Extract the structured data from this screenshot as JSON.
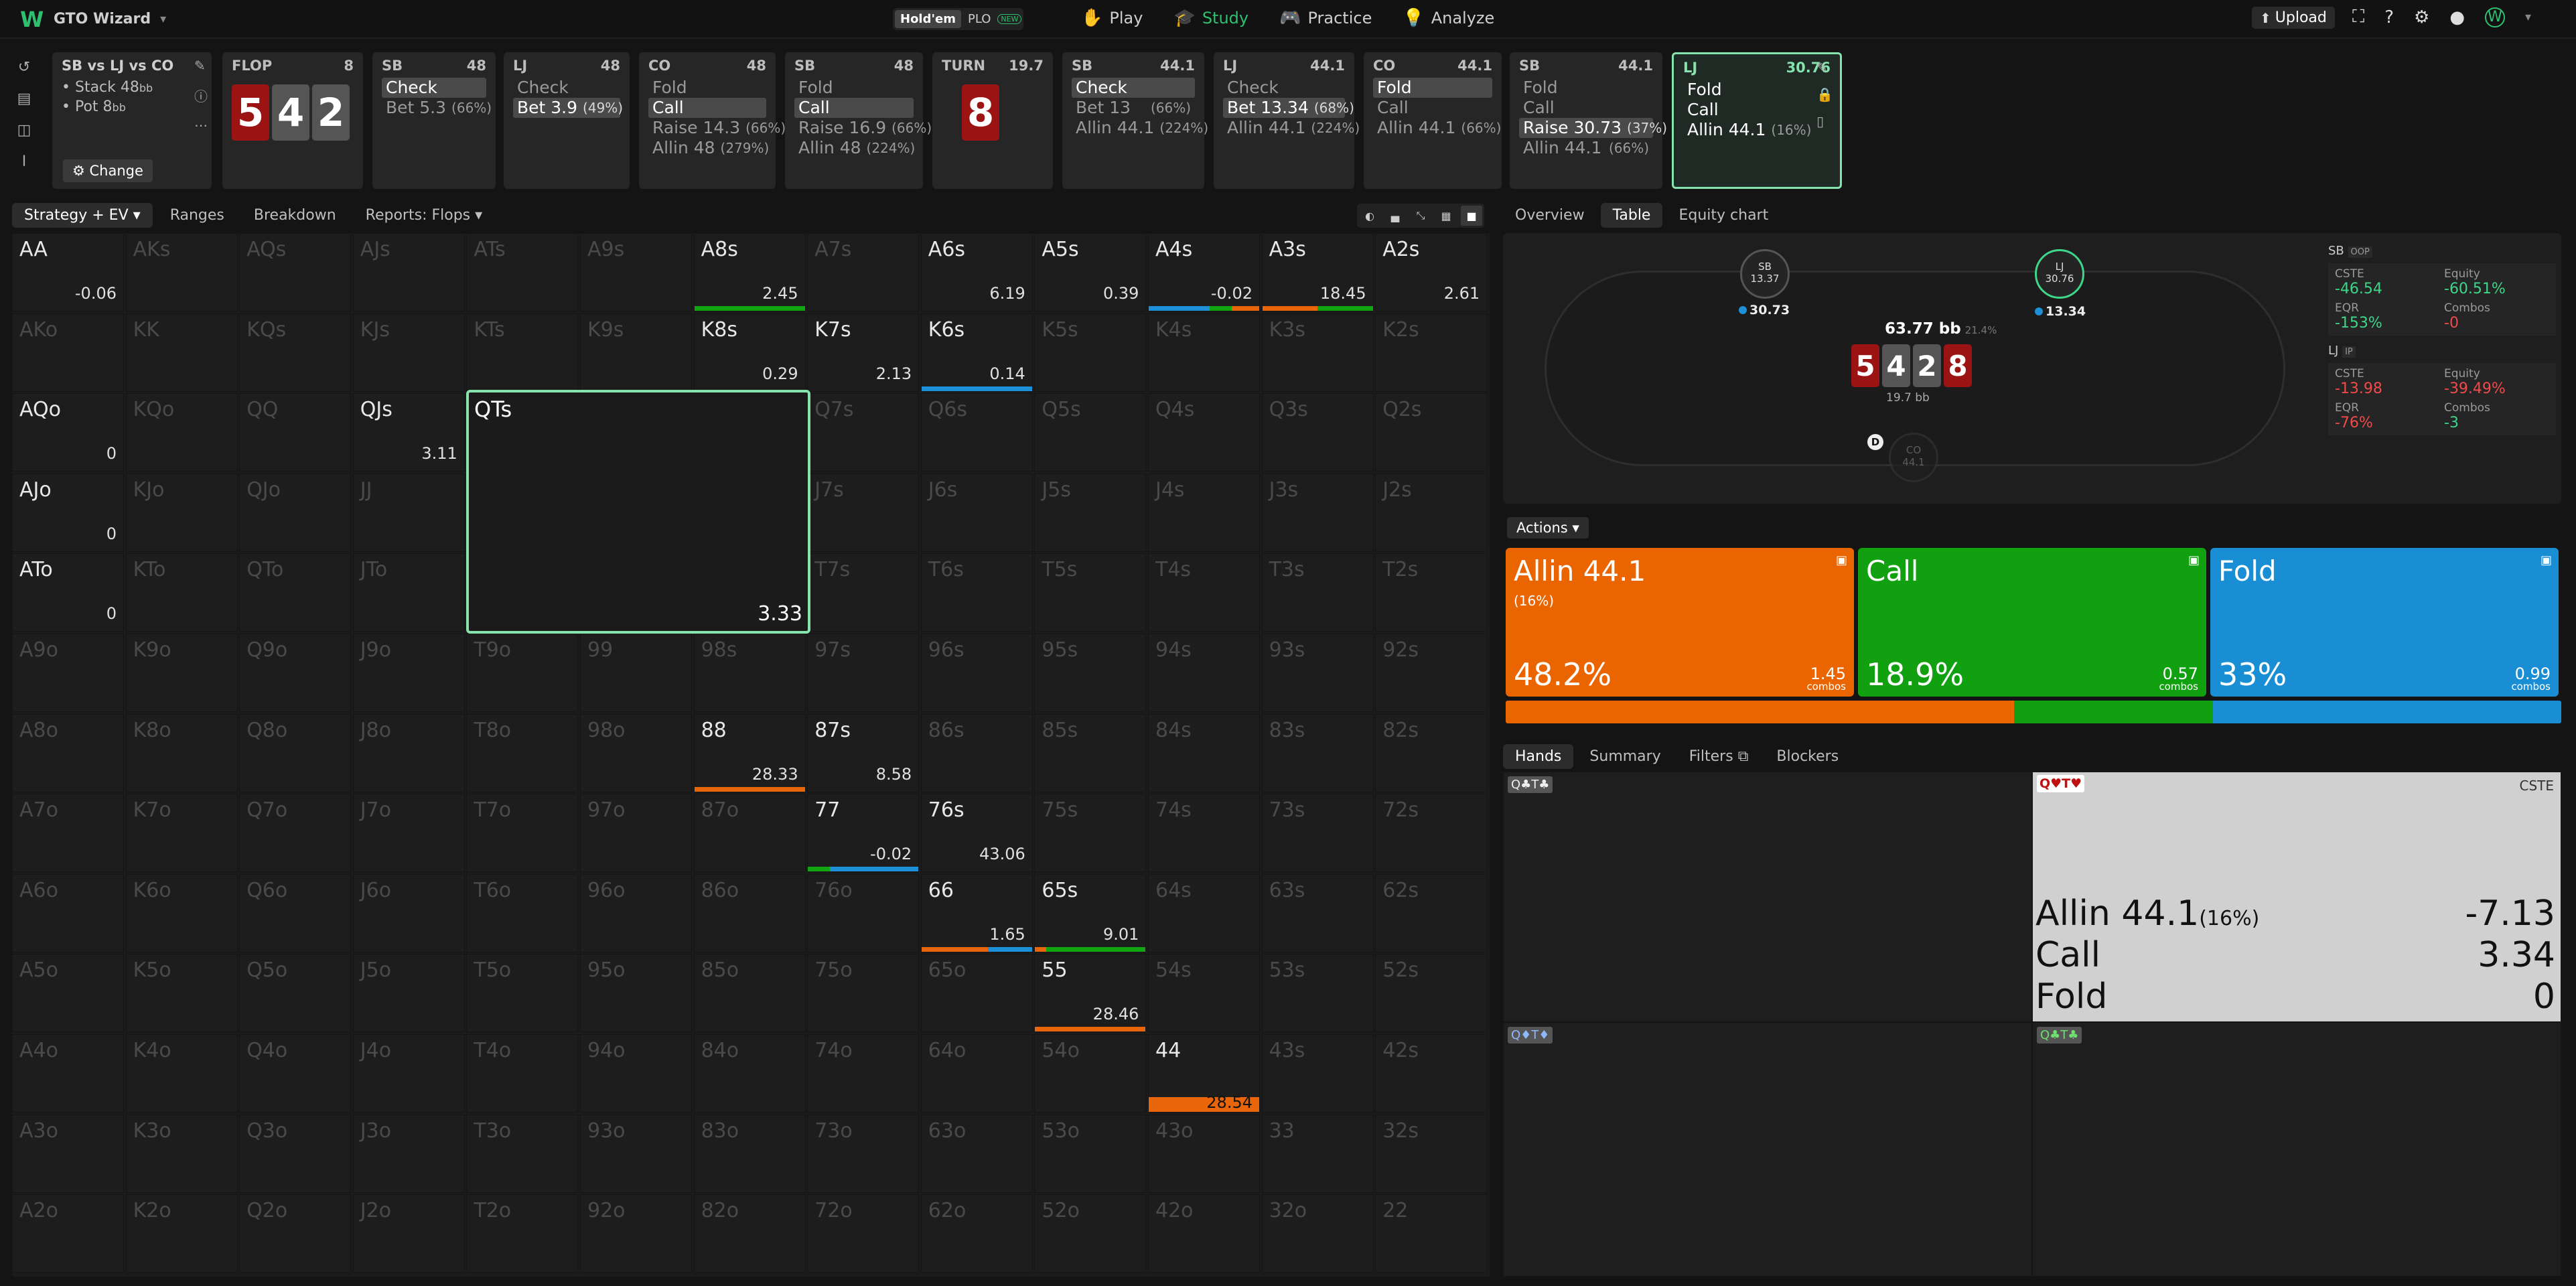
{
  "nav": {
    "brand": "GTO Wizard",
    "game_tabs": [
      "Hold'em",
      "PLO"
    ],
    "plo_badge": "NEW",
    "menu": [
      "Play",
      "Study",
      "Practice",
      "Analyze"
    ],
    "upload": "Upload",
    "accent": "#2fbf71"
  },
  "spot": {
    "title": "SB vs LJ vs CO",
    "stack": "Stack 48",
    "stack_unit": "bb",
    "pot": "Pot 8",
    "pot_unit": "bb",
    "change": "Change"
  },
  "actions_bar": [
    {
      "pos": "FLOP",
      "val": "8",
      "board": [
        "5",
        "4",
        "2"
      ]
    },
    {
      "pos": "SB",
      "val": "48",
      "rows": [
        {
          "t": "Check",
          "p": "",
          "sel": true
        },
        {
          "t": "Bet 5.3",
          "p": "(66%)",
          "sel": false
        }
      ]
    },
    {
      "pos": "LJ",
      "val": "48",
      "rows": [
        {
          "t": "Check",
          "p": "",
          "sel": false
        },
        {
          "t": "Bet 3.9",
          "p": "(49%)",
          "sel": true
        }
      ]
    },
    {
      "pos": "CO",
      "val": "48",
      "rows": [
        {
          "t": "Fold",
          "p": "",
          "sel": false
        },
        {
          "t": "Call",
          "p": "",
          "sel": true
        },
        {
          "t": "Raise 14.3",
          "p": "(66%)",
          "sel": false
        },
        {
          "t": "Allin 48",
          "p": "(279%)",
          "sel": false
        }
      ]
    },
    {
      "pos": "SB",
      "val": "48",
      "rows": [
        {
          "t": "Fold",
          "p": "",
          "sel": false
        },
        {
          "t": "Call",
          "p": "",
          "sel": true
        },
        {
          "t": "Raise 16.9",
          "p": "(66%)",
          "sel": false
        },
        {
          "t": "Allin 48",
          "p": "(224%)",
          "sel": false
        }
      ]
    },
    {
      "pos": "TURN",
      "val": "19.7",
      "board": [
        "8"
      ]
    },
    {
      "pos": "SB",
      "val": "44.1",
      "rows": [
        {
          "t": "Check",
          "p": "",
          "sel": true
        },
        {
          "t": "Bet 13",
          "p": "(66%)",
          "sel": false
        },
        {
          "t": "Allin 44.1",
          "p": "(224%)",
          "sel": false
        }
      ]
    },
    {
      "pos": "LJ",
      "val": "44.1",
      "rows": [
        {
          "t": "Check",
          "p": "",
          "sel": false
        },
        {
          "t": "Bet 13.34",
          "p": "(68%)",
          "sel": true
        },
        {
          "t": "Allin 44.1",
          "p": "(224%)",
          "sel": false
        }
      ]
    },
    {
      "pos": "CO",
      "val": "44.1",
      "rows": [
        {
          "t": "Fold",
          "p": "",
          "sel": true
        },
        {
          "t": "Call",
          "p": "",
          "sel": false
        },
        {
          "t": "Allin 44.1",
          "p": "(66%)",
          "sel": false
        }
      ]
    },
    {
      "pos": "SB",
      "val": "44.1",
      "rows": [
        {
          "t": "Fold",
          "p": "",
          "sel": false
        },
        {
          "t": "Call",
          "p": "",
          "sel": false
        },
        {
          "t": "Raise 30.73",
          "p": "(37%)",
          "sel": true
        },
        {
          "t": "Allin 44.1",
          "p": "(66%)",
          "sel": false
        }
      ]
    },
    {
      "pos": "LJ",
      "val": "30.76",
      "rows": [
        {
          "t": "Fold",
          "p": "",
          "sel": false
        },
        {
          "t": "Call",
          "p": "",
          "sel": false
        },
        {
          "t": "Allin 44.1",
          "p": "(16%)",
          "sel": false
        }
      ]
    }
  ],
  "grid_tabs": [
    "Strategy + EV",
    "Ranges",
    "Breakdown",
    "Reports: Flops"
  ],
  "ranks": [
    "A",
    "K",
    "Q",
    "J",
    "T",
    "9",
    "8",
    "7",
    "6",
    "5",
    "4",
    "3",
    "2"
  ],
  "active_cells": {
    "AA": {
      "ev": "-0.06",
      "bar": [
        [
          "#1e90d8",
          0.0
        ],
        [
          "#11a511",
          0.0
        ],
        [
          "#e8650a",
          0.0
        ]
      ]
    },
    "A8s": {
      "ev": "2.45",
      "bar": [
        [
          "#11a511",
          1.0
        ]
      ]
    },
    "A6s": {
      "ev": "6.19",
      "bar": []
    },
    "A5s": {
      "ev": "0.39",
      "bar": []
    },
    "A4s": {
      "ev": "-0.02",
      "bar": [
        [
          "#1e90d8",
          0.55
        ],
        [
          "#11a511",
          0.2
        ],
        [
          "#e8650a",
          0.25
        ]
      ]
    },
    "A3s": {
      "ev": "18.45",
      "bar": [
        [
          "#e8650a",
          0.5
        ],
        [
          "#11a511",
          0.5
        ]
      ]
    },
    "A2s": {
      "ev": "2.61",
      "bar": []
    },
    "K8s": {
      "ev": "0.29",
      "bar": []
    },
    "K7s": {
      "ev": "2.13",
      "bar": []
    },
    "K6s": {
      "ev": "0.14",
      "bar": [
        [
          "#1e90d8",
          1.0
        ]
      ]
    },
    "AQo": {
      "ev": "0",
      "bar": []
    },
    "QJs": {
      "ev": "3.11",
      "bar": []
    },
    "AJo": {
      "ev": "0",
      "bar": []
    },
    "ATo": {
      "ev": "0",
      "bar": []
    },
    "88": {
      "ev": "28.33",
      "bar": [
        [
          "#e8650a",
          1.0
        ]
      ]
    },
    "87s": {
      "ev": "8.58",
      "bar": []
    },
    "77": {
      "ev": "-0.02",
      "bar": [
        [
          "#11a511",
          0.2
        ],
        [
          "#1e90d8",
          0.8
        ]
      ]
    },
    "76s": {
      "ev": "43.06",
      "bar": []
    },
    "66": {
      "ev": "1.65",
      "bar": [
        [
          "#e8650a",
          0.6
        ],
        [
          "#1e90d8",
          0.4
        ]
      ]
    },
    "65s": {
      "ev": "9.01",
      "bar": [
        [
          "#e8650a",
          0.1
        ],
        [
          "#11a511",
          0.9
        ]
      ]
    },
    "55": {
      "ev": "28.46",
      "bar": [
        [
          "#e8650a",
          1.0
        ]
      ]
    },
    "44": {
      "ev": "28.54",
      "bar": [
        [
          "#e8650a",
          1.0
        ]
      ],
      "thick": true
    }
  },
  "selected_cell": {
    "label": "QTs",
    "ev": "3.33"
  },
  "right_tabs": [
    "Overview",
    "Table",
    "Equity chart"
  ],
  "table": {
    "sb": {
      "name": "SB",
      "stack": "13.37",
      "bet": "30.73"
    },
    "lj": {
      "name": "LJ",
      "stack": "30.76",
      "bet": "13.34"
    },
    "co": {
      "name": "CO",
      "stack": "44.1"
    },
    "pot": "63.77 bb",
    "pot_pct": "21.4%",
    "board": [
      "5",
      "4",
      "2",
      "8"
    ],
    "sub_pot": "19.7 bb",
    "dealer": "D"
  },
  "stats": {
    "sb_label": "SB",
    "sb_tag": "OOP",
    "sb": {
      "cste": "-46.54",
      "equity": "-60.51%",
      "eqr": "-153%",
      "combos": "-0"
    },
    "lj_label": "LJ",
    "lj_tag": "IP",
    "lj": {
      "cste": "-13.98",
      "equity": "-39.49%",
      "eqr": "-76%",
      "combos": "-3"
    },
    "keys": {
      "cste": "CSTE",
      "equity": "Equity",
      "eqr": "EQR",
      "combos": "Combos"
    }
  },
  "actions_menu": "Actions",
  "big_actions": [
    {
      "name": "Allin 44.1",
      "sub": "(16%)",
      "pct": "48.2%",
      "combos": "1.45",
      "color": "#ea6400",
      "frac": 0.482
    },
    {
      "name": "Call",
      "sub": "",
      "pct": "18.9%",
      "combos": "0.57",
      "color": "#10a010",
      "frac": 0.189
    },
    {
      "name": "Fold",
      "sub": "",
      "pct": "33%",
      "combos": "0.99",
      "color": "#1a8ed4",
      "frac": 0.33
    }
  ],
  "combos_word": "combos",
  "bottom_tabs": [
    "Hands",
    "Summary",
    "Filters",
    "Blockers"
  ],
  "hands": {
    "h1": "Q♣T♣",
    "h2": "Q♥T♥",
    "h3": "Q♦T♦",
    "h4": "Q♣T♣",
    "cste": "CSTE",
    "rows": [
      {
        "name": "Allin 44.1",
        "sub": "(16%)",
        "v": "-7.13"
      },
      {
        "name": "Call",
        "sub": "",
        "v": "3.34"
      },
      {
        "name": "Fold",
        "sub": "",
        "v": "0"
      }
    ]
  }
}
